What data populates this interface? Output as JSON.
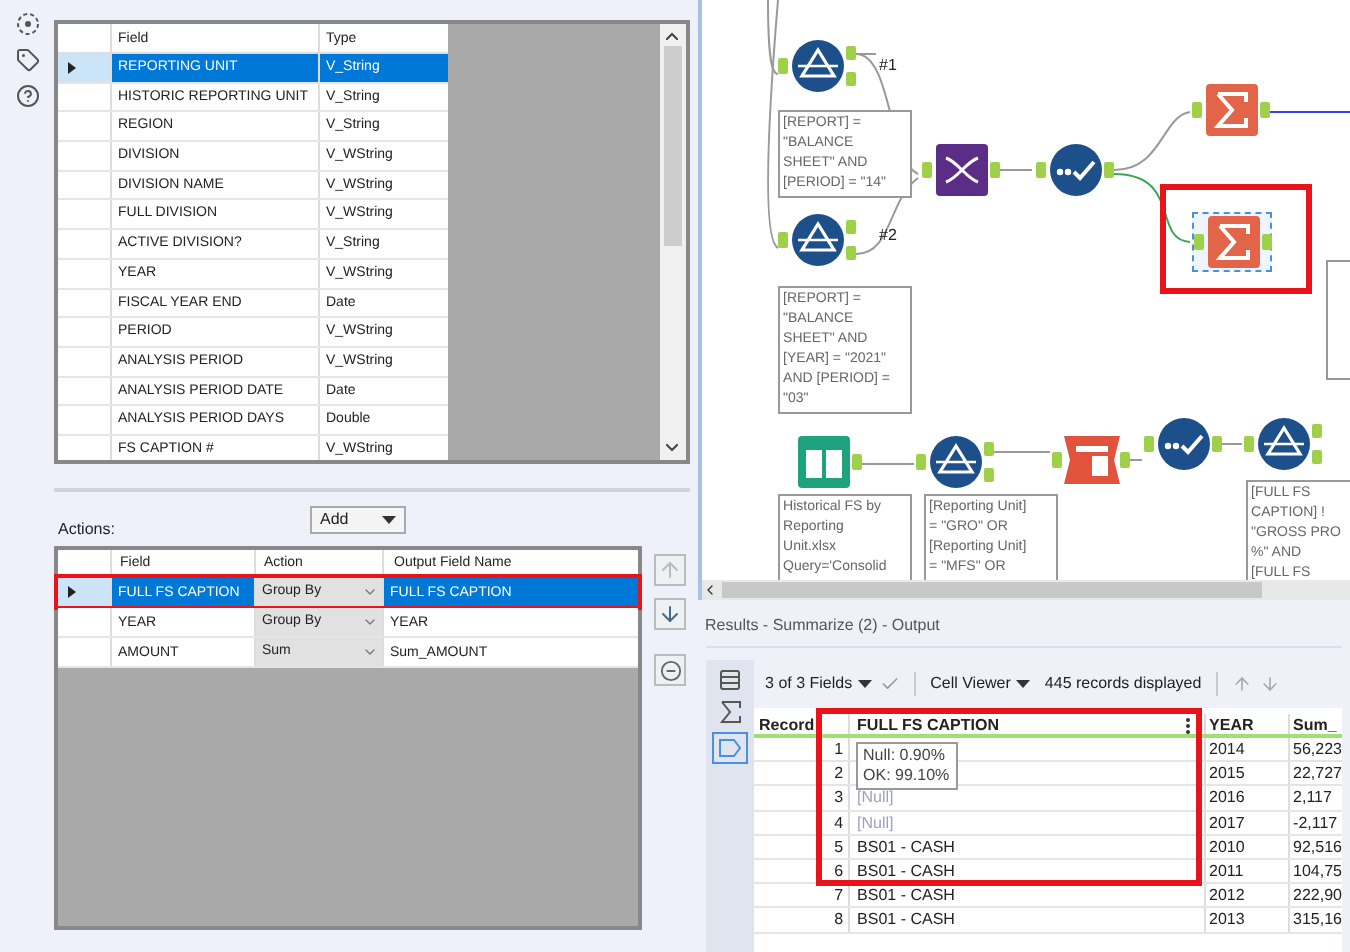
{
  "fields_grid": {
    "columns": [
      "Field",
      "Type"
    ],
    "rows": [
      {
        "field": "REPORTING UNIT",
        "type": "V_String",
        "selected": true
      },
      {
        "field": "HISTORIC REPORTING UNIT",
        "type": "V_String",
        "selected": false
      },
      {
        "field": "REGION",
        "type": "V_String",
        "selected": false
      },
      {
        "field": "DIVISION",
        "type": "V_WString",
        "selected": false
      },
      {
        "field": "DIVISION NAME",
        "type": "V_WString",
        "selected": false
      },
      {
        "field": "FULL DIVISION",
        "type": "V_WString",
        "selected": false
      },
      {
        "field": "ACTIVE DIVISION?",
        "type": "V_String",
        "selected": false
      },
      {
        "field": "YEAR",
        "type": "V_WString",
        "selected": false
      },
      {
        "field": "FISCAL YEAR END",
        "type": "Date",
        "selected": false
      },
      {
        "field": "PERIOD",
        "type": "V_WString",
        "selected": false
      },
      {
        "field": "ANALYSIS PERIOD",
        "type": "V_WString",
        "selected": false
      },
      {
        "field": "ANALYSIS PERIOD DATE",
        "type": "Date",
        "selected": false
      },
      {
        "field": "ANALYSIS PERIOD DAYS",
        "type": "Double",
        "selected": false
      },
      {
        "field": "FS CAPTION #",
        "type": "V_WString",
        "selected": false
      }
    ]
  },
  "actions": {
    "label": "Actions:",
    "add_menu": "Add",
    "columns": [
      "Field",
      "Action",
      "Output Field Name"
    ],
    "rows": [
      {
        "field": "FULL FS CAPTION",
        "action": "Group By",
        "output": "FULL FS CAPTION",
        "selected": true
      },
      {
        "field": "YEAR",
        "action": "Group By",
        "output": "YEAR",
        "selected": false
      },
      {
        "field": "AMOUNT",
        "action": "Sum",
        "output": "Sum_AMOUNT",
        "selected": false
      }
    ]
  },
  "canvas": {
    "nodes": [
      {
        "kind": "filter",
        "label": "#1",
        "selected": false
      },
      {
        "kind": "filter",
        "label": "#2",
        "selected": false
      },
      {
        "kind": "join",
        "selected": false
      },
      {
        "kind": "select",
        "selected": false
      },
      {
        "kind": "summarize",
        "selected": false
      },
      {
        "kind": "summarize",
        "selected": true
      },
      {
        "kind": "input",
        "selected": false
      },
      {
        "kind": "filter",
        "selected": false
      },
      {
        "kind": "crosstab",
        "selected": false
      },
      {
        "kind": "select",
        "selected": false
      },
      {
        "kind": "filter",
        "selected": false
      }
    ],
    "notes": [
      "[REPORT] =\n\"BALANCE\nSHEET\" AND\n[PERIOD] = \"14\"",
      "[REPORT] =\n\"BALANCE\nSHEET\" AND\n[YEAR] = \"2021\"\nAND [PERIOD] =\n\"03\"",
      "Historical FS by\nReporting\nUnit.xlsx\nQuery='Consolid",
      "[Reporting Unit]\n= \"GRO\" OR\n[Reporting Unit]\n= \"MFS\" OR",
      "[FULL FS\nCAPTION] !\n\"GROSS PRO\n%\" AND\n[FULL FS"
    ]
  },
  "results": {
    "title": "Results - Summarize (2) - Output",
    "fields_menu": "3 of 3 Fields",
    "viewer_menu": "Cell Viewer",
    "record_count": "445 records displayed",
    "columns": [
      "Record",
      "FULL FS CAPTION",
      "YEAR",
      "Sum_"
    ],
    "rows": [
      {
        "record": "1",
        "year": "2014",
        "sum": "56,223"
      },
      {
        "record": "2",
        "year": "2015",
        "sum": "22,727"
      },
      {
        "record": "3",
        "caption": "[Null]",
        "null": true,
        "year": "2016",
        "sum": "2,117"
      },
      {
        "record": "4",
        "caption": "[Null]",
        "null": true,
        "year": "2017",
        "sum": "-2,117"
      },
      {
        "record": "5",
        "caption": "BS01 - CASH",
        "null": false,
        "year": "2010",
        "sum": "92,516"
      },
      {
        "record": "6",
        "caption": "BS01 - CASH",
        "null": false,
        "year": "2011",
        "sum": "104,75"
      },
      {
        "record": "7",
        "caption": "BS01 - CASH",
        "null": false,
        "year": "2012",
        "sum": "222,90"
      },
      {
        "record": "8",
        "caption": "BS01 - CASH",
        "null": false,
        "year": "2013",
        "sum": "315,16"
      }
    ],
    "tooltip": [
      "Null: 0.90%",
      "OK: 99.10%"
    ]
  }
}
